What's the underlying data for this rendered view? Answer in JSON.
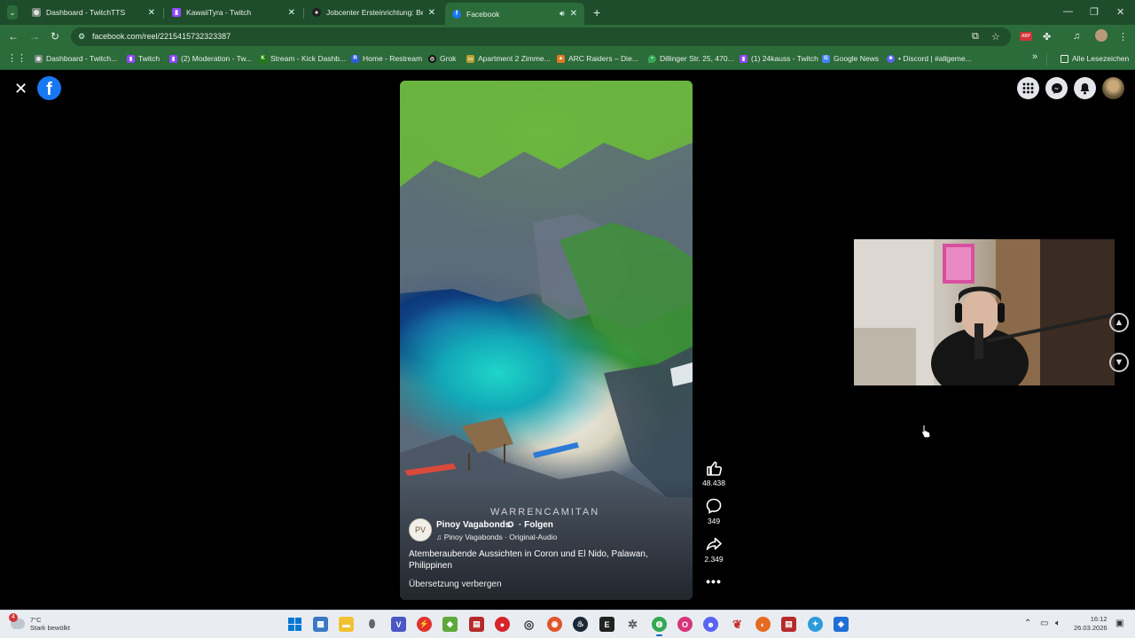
{
  "tabs": [
    {
      "title": "Dashboard - TwitchTTS",
      "favicon_color": "#7a8c7f",
      "favicon_icon": "globe-icon"
    },
    {
      "title": "KawaiiTyra - Twitch",
      "favicon_color": "#9146ff",
      "favicon_icon": "twitch-icon"
    },
    {
      "title": "Jobcenter Ersteinrichtung: Betr",
      "favicon_color": "#222222",
      "favicon_icon": "github-icon"
    },
    {
      "title": "Facebook",
      "favicon_color": "#1877f2",
      "favicon_icon": "facebook-icon",
      "active": true
    }
  ],
  "address_bar": {
    "url": "facebook.com/reel/2215415732323387"
  },
  "bookmarks": [
    {
      "label": "Dashboard - Twitch...",
      "color": "#7a8c7f"
    },
    {
      "label": "Twitch",
      "color": "#9146ff"
    },
    {
      "label": "(2) Moderation - Tw...",
      "color": "#9146ff"
    },
    {
      "label": "Stream - Kick Dashb...",
      "color": "#53fc18"
    },
    {
      "label": "Home - Restream",
      "color": "#2b5cd9"
    },
    {
      "label": "Grok",
      "color": "#111111"
    },
    {
      "label": "Apartment 2 Zimme...",
      "color": "#f5c518"
    },
    {
      "label": "ARC Raiders – Die...",
      "color": "#e07b20"
    },
    {
      "label": "Dillinger Str. 25, 470...",
      "color": "#34a853"
    },
    {
      "label": "(1) 24kauss - Twitch",
      "color": "#9146ff"
    },
    {
      "label": "Google News",
      "color": "#4285f4"
    },
    {
      "label": "• Discord | #allgeme...",
      "color": "#5865f2"
    }
  ],
  "bookmarks_all_label": "Alle Lesezeichen",
  "reel": {
    "watermark": "WARRENCAMITAN",
    "author": "Pinoy Vagabonds",
    "follow": "· Folgen",
    "audio": "Pinoy Vagabonds · Original-Audio",
    "caption": "Atemberaubende Aussichten in Coron und El Nido, Palawan, Philippinen",
    "translate_toggle": "Übersetzung verbergen"
  },
  "actions": {
    "likes": "48.438",
    "comments": "349",
    "shares": "2.349"
  },
  "taskbar": {
    "weather_temp": "7°C",
    "weather_desc": "Stark bewölkt",
    "weather_badge": "4",
    "time": "16:12",
    "date": "26.03.2026"
  },
  "colors": {
    "chrome_dark": "#1e4d2b",
    "chrome": "#2c6b3a",
    "facebook_blue": "#1877f2"
  }
}
